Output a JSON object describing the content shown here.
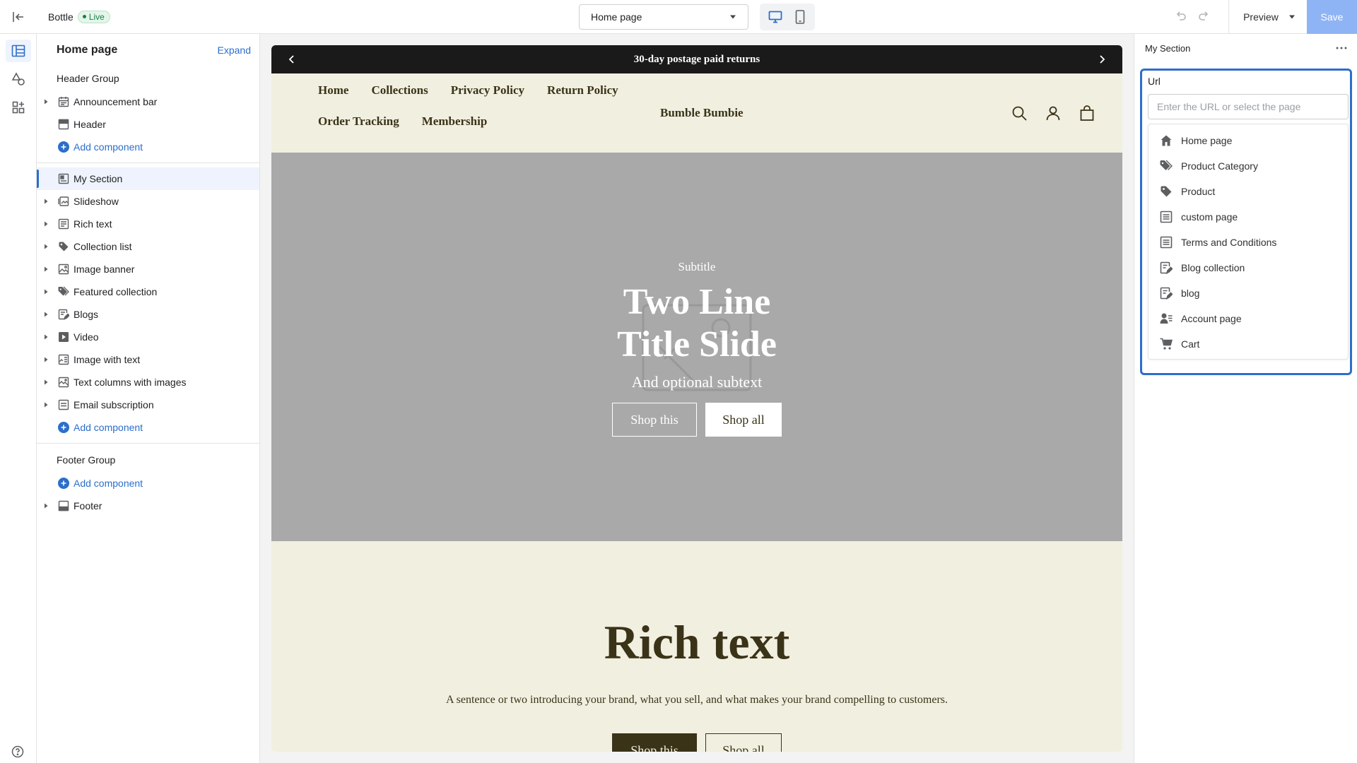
{
  "topbar": {
    "store_name": "Bottle",
    "status": "Live",
    "page_select": "Home page",
    "preview_label": "Preview",
    "save_label": "Save"
  },
  "left_panel": {
    "title": "Home page",
    "expand_label": "Expand",
    "header_group": "Header Group",
    "header_items": [
      {
        "label": "Announcement bar",
        "icon": "calendar-icon"
      },
      {
        "label": "Header",
        "icon": "header-icon"
      }
    ],
    "add_component": "Add component",
    "selected_item": "My Section",
    "sections": [
      {
        "label": "Slideshow",
        "icon": "slideshow-icon"
      },
      {
        "label": "Rich text",
        "icon": "text-block-icon"
      },
      {
        "label": "Collection list",
        "icon": "tag-icon"
      },
      {
        "label": "Image banner",
        "icon": "image-icon"
      },
      {
        "label": "Featured collection",
        "icon": "tags-icon"
      },
      {
        "label": "Blogs",
        "icon": "blog-icon"
      },
      {
        "label": "Video",
        "icon": "video-icon"
      },
      {
        "label": "Image with text",
        "icon": "image-text-icon"
      },
      {
        "label": "Text columns with images",
        "icon": "columns-icon"
      },
      {
        "label": "Email subscription",
        "icon": "email-icon"
      }
    ],
    "footer_group": "Footer Group",
    "footer_item": "Footer"
  },
  "canvas": {
    "announcement": "30-day postage paid returns",
    "nav": [
      "Home",
      "Collections",
      "Privacy Policy",
      "Return Policy",
      "Order Tracking",
      "Membership"
    ],
    "brand": "Bumble Bumbie",
    "slide": {
      "subtitle": "Subtitle",
      "title_line1": "Two Line",
      "title_line2": "Title Slide",
      "text": "And optional subtext",
      "btn1": "Shop this",
      "btn2": "Shop all"
    },
    "rich": {
      "title": "Rich text",
      "text": "A sentence or two introducing your brand, what you sell, and what makes your brand compelling to customers.",
      "btn1": "Shop this",
      "btn2": "Shop all"
    }
  },
  "right_panel": {
    "title": "My Section",
    "field_label": "Url",
    "placeholder": "Enter the URL or select the page",
    "options": [
      {
        "label": "Home page",
        "icon": "home-icon"
      },
      {
        "label": "Product Category",
        "icon": "tags-icon"
      },
      {
        "label": "Product",
        "icon": "tag-icon"
      },
      {
        "label": "custom page",
        "icon": "page-icon"
      },
      {
        "label": "Terms and Conditions",
        "icon": "page-icon"
      },
      {
        "label": "Blog collection",
        "icon": "blog-icon"
      },
      {
        "label": "blog",
        "icon": "blog-icon"
      },
      {
        "label": "Account page",
        "icon": "account-icon"
      },
      {
        "label": "Cart",
        "icon": "cart-icon"
      }
    ]
  },
  "colors": {
    "accent": "#2c6ecb",
    "save_disabled": "#8fb4f5",
    "shop_bg": "#f1efe0",
    "shop_text": "#3a3318",
    "slide_bg": "#a9a9a9"
  }
}
